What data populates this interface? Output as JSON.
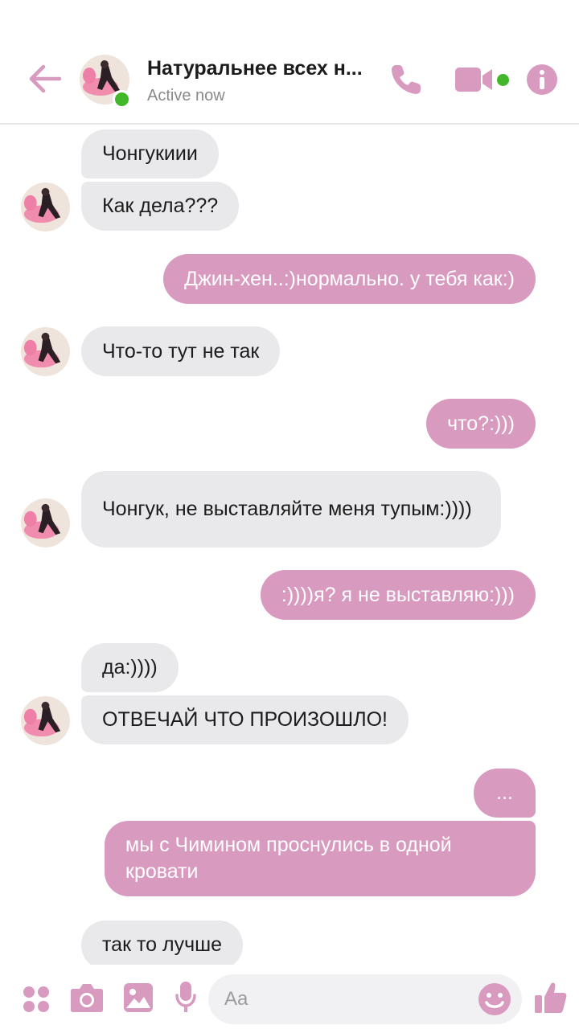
{
  "header": {
    "title": "Натуральнее всех н...",
    "status": "Active now"
  },
  "messages": [
    {
      "side": "in",
      "text": "Чонгукиии"
    },
    {
      "side": "in",
      "text": "Как дела???"
    },
    {
      "side": "out",
      "text": "Джин-хен..:)нормально. у тебя как:)"
    },
    {
      "side": "in",
      "text": "Что-то тут не так"
    },
    {
      "side": "out",
      "text": "что?:)))"
    },
    {
      "side": "in",
      "text": "Чонгук, не выставляйте меня тупым:))))"
    },
    {
      "side": "out",
      "text": ":))))я? я не выставляю:)))"
    },
    {
      "side": "in",
      "text": "да:))))"
    },
    {
      "side": "in",
      "text": "ОТВЕЧАЙ ЧТО ПРОИЗОШЛО!"
    },
    {
      "side": "out",
      "text": "..."
    },
    {
      "side": "out",
      "text": "мы с Чимином проснулись в одной кровати"
    },
    {
      "side": "in",
      "text": "так то лучше"
    }
  ],
  "composer": {
    "placeholder": "Aa"
  },
  "colors": {
    "accent": "#d99ac0",
    "incoming": "#e9e9ec",
    "online": "#42b72a"
  },
  "icons": [
    "back-arrow-icon",
    "phone-icon",
    "video-camera-icon",
    "info-icon",
    "apps-icon",
    "camera-icon",
    "gallery-icon",
    "microphone-icon",
    "emoji-icon",
    "thumbs-up-icon"
  ]
}
